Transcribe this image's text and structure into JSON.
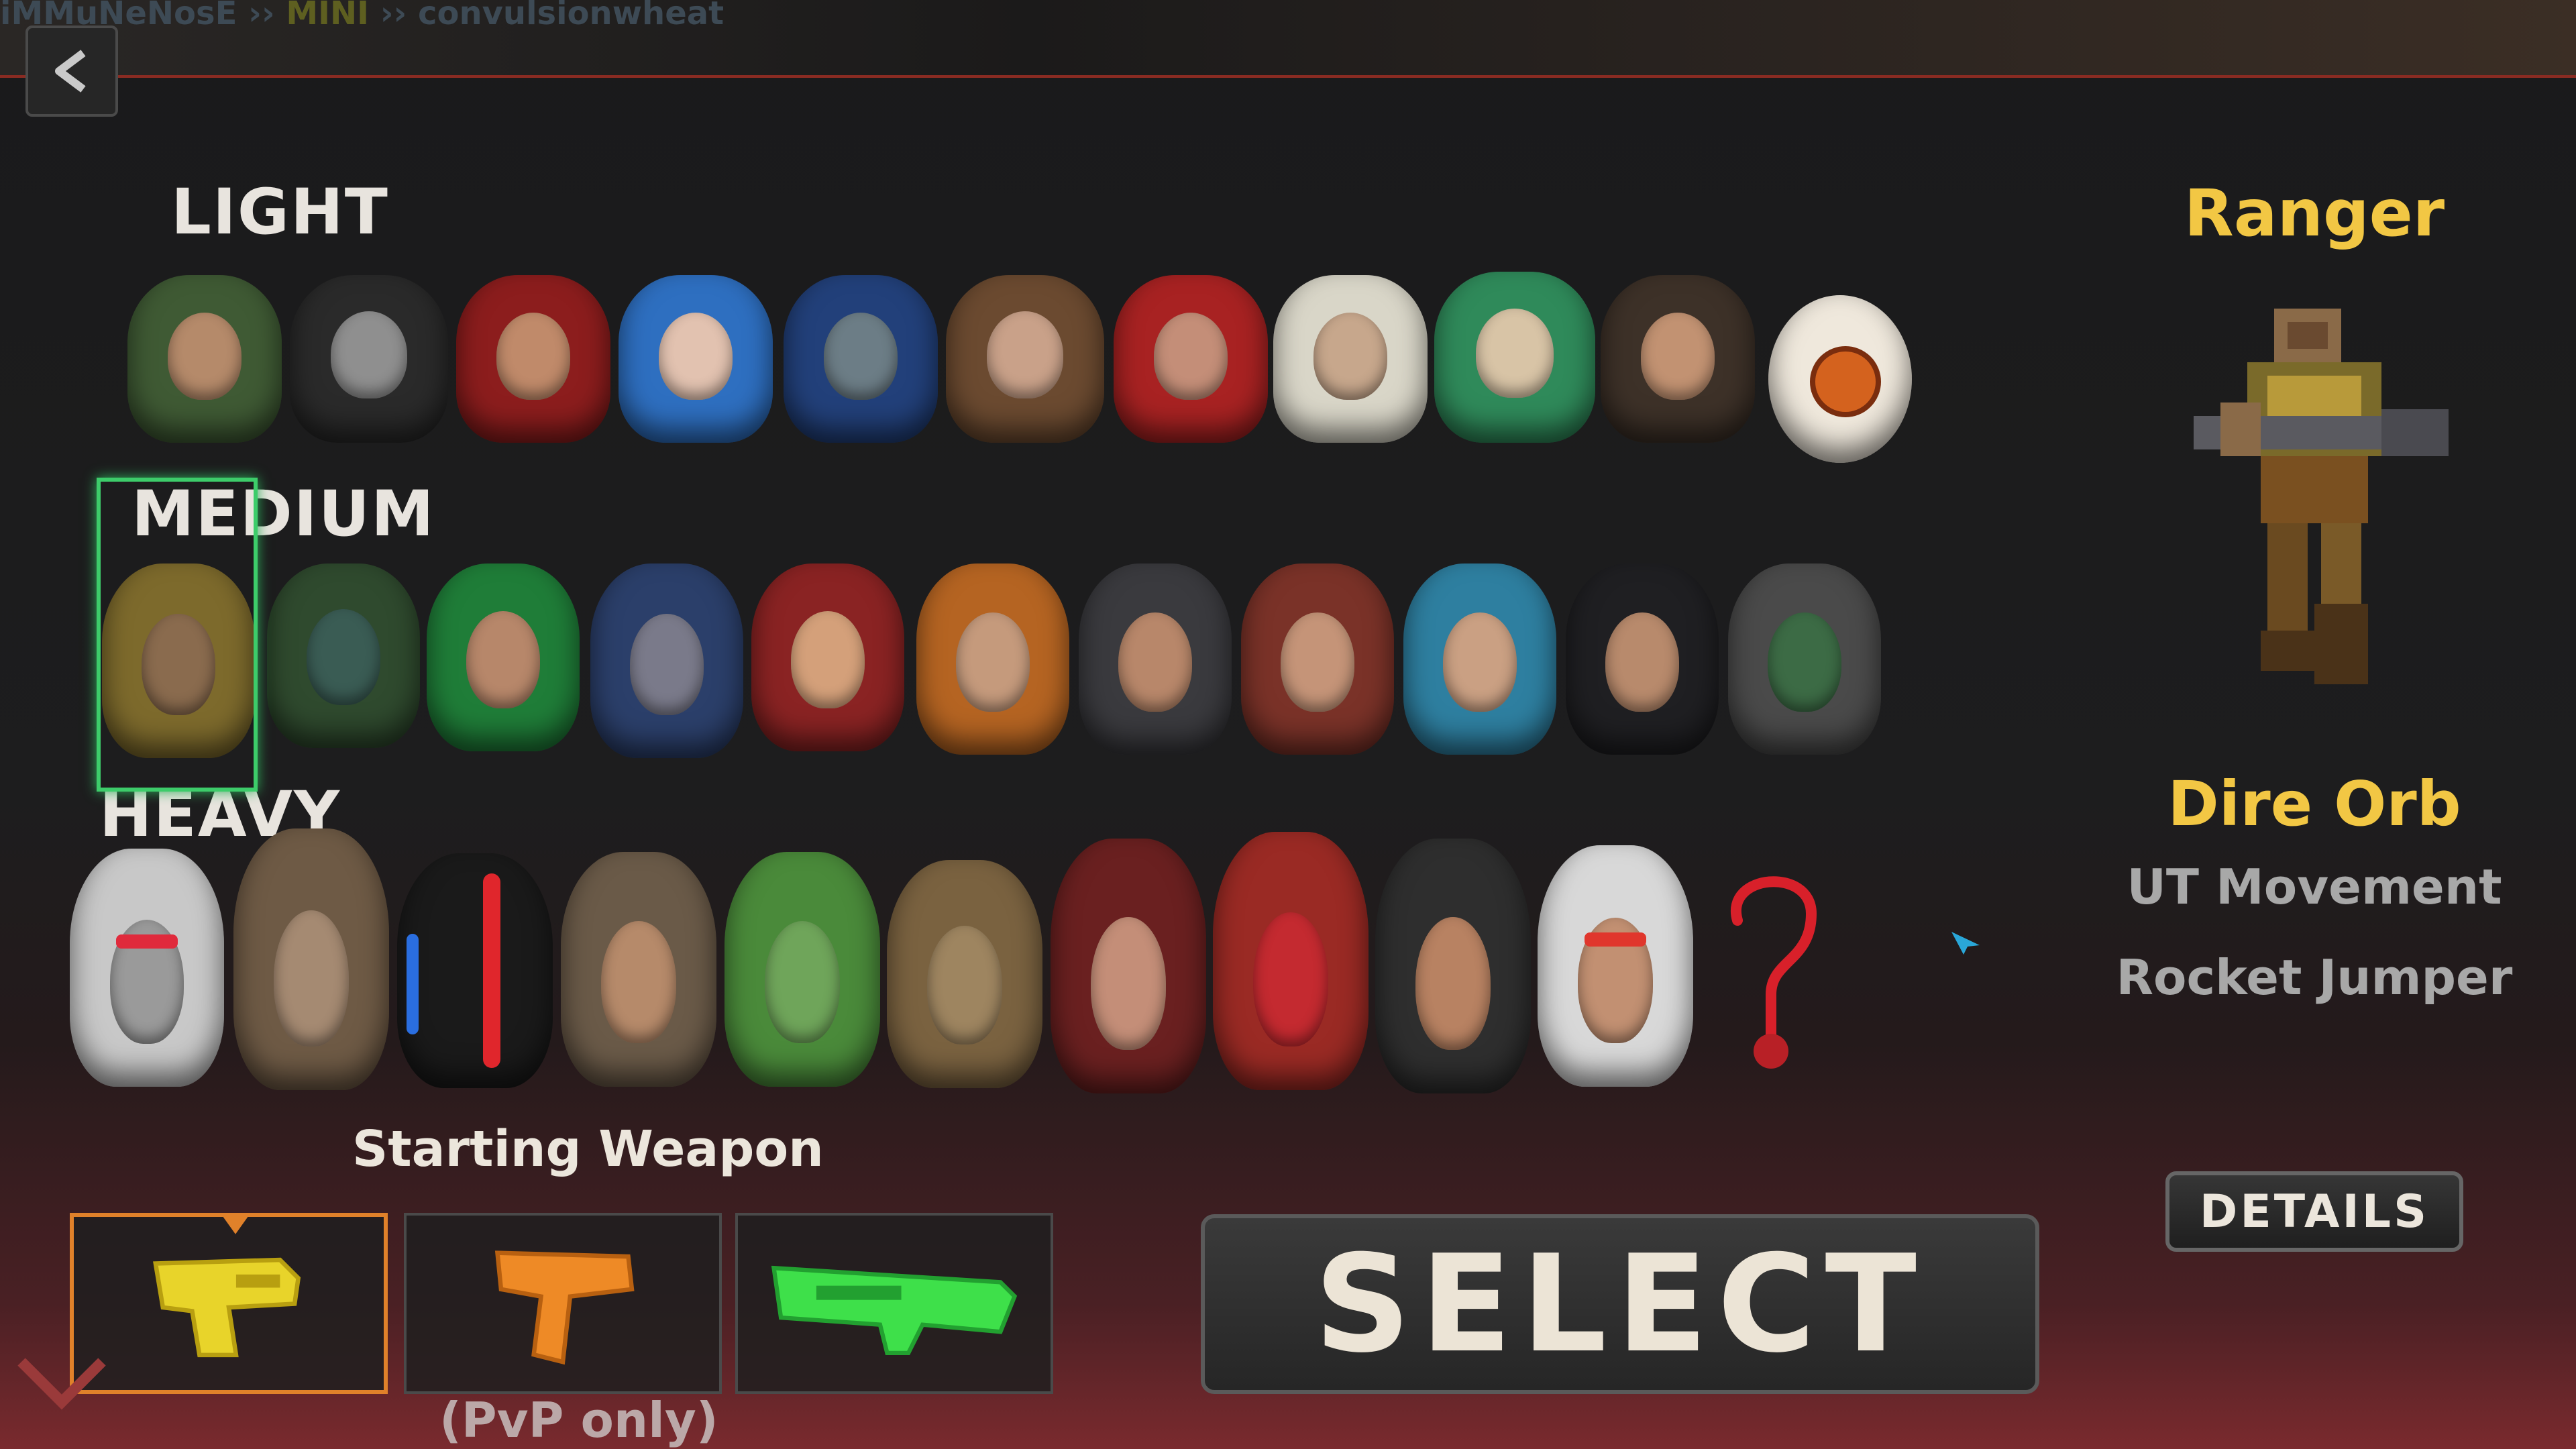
{
  "breadcrumb": {
    "user": "iMMuNeNosE",
    "sep1": " ›› ",
    "mode": "MINI",
    "sep2": " ›› ",
    "map": "convulsionwheat"
  },
  "classes": {
    "light": "LIGHT",
    "medium": "MEDIUM",
    "heavy": "HEAVY"
  },
  "character": {
    "name": "Ranger",
    "ability": "Dire Orb",
    "perk1": "UT Movement",
    "perk2": "Rocket Jumper"
  },
  "weapon": {
    "title": "Starting Weapon",
    "pvp_note": "(PvP only)"
  },
  "buttons": {
    "select": "SELECT",
    "details": "DETAILS"
  },
  "colors": {
    "accent": "#f2c744",
    "selection": "#3dcc6a",
    "weapon_frame": "#e0812a",
    "topbar_line": "#8a2b22"
  }
}
